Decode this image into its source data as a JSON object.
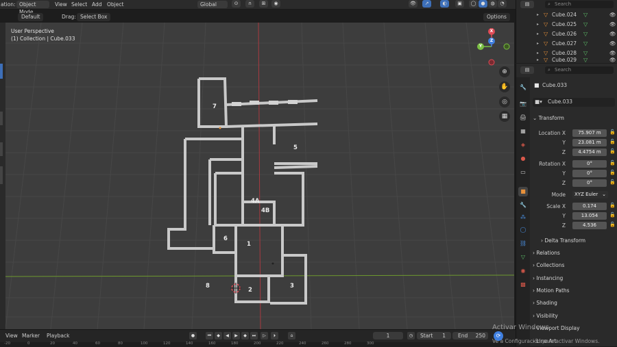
{
  "header": {
    "mode_prefix": "ation:",
    "mode": "Object Mode",
    "menus": [
      "View",
      "Select",
      "Add",
      "Object"
    ],
    "transform_orientation": "Global",
    "options": "Options"
  },
  "tool_header": {
    "orientation": "Default",
    "drag_label": "Drag:",
    "drag_value": "Select Box"
  },
  "viewport": {
    "perspective": "User Perspective",
    "collection": "(1) Collection | Cube.033",
    "room_labels": [
      "7",
      "5",
      "4A",
      "4B",
      "6",
      "1",
      "8",
      "2",
      "3"
    ],
    "gizmo": {
      "x": "X",
      "y": "Y",
      "z": "Z"
    }
  },
  "timeline": {
    "menus": [
      "View",
      "Marker",
      "Playback"
    ],
    "current_frame": "1",
    "start_label": "Start",
    "start": "1",
    "end_label": "End",
    "end": "250",
    "ruler": [
      "-20",
      "0",
      "20",
      "40",
      "60",
      "80",
      "100",
      "120",
      "140",
      "160",
      "180",
      "200",
      "220",
      "240",
      "260",
      "280",
      "300"
    ]
  },
  "outliner": {
    "search_placeholder": "Search",
    "items": [
      "Cube.024",
      "Cube.025",
      "Cube.026",
      "Cube.027",
      "Cube.028",
      "Cube.029"
    ]
  },
  "properties": {
    "search_placeholder": "Search",
    "object_name": "Cube.033",
    "data_name": "Cube.033",
    "transform_header": "Transform",
    "location": {
      "label": "Location",
      "x": "75.907 m",
      "y": "23.081 m",
      "z": "4.4754 m"
    },
    "rotation": {
      "label": "Rotation",
      "x": "0°",
      "y": "0°",
      "z": "0°"
    },
    "mode": {
      "label": "Mode",
      "value": "XYZ Euler"
    },
    "scale": {
      "label": "Scale",
      "x": "0.174",
      "y": "13.054",
      "z": "4.536"
    },
    "axes": [
      "X",
      "Y",
      "Z"
    ],
    "delta": "Delta Transform",
    "sections": [
      "Relations",
      "Collections",
      "Instancing",
      "Motion Paths",
      "Shading",
      "Visibility",
      "Viewport Display",
      "Line Art"
    ]
  },
  "watermark": {
    "line1": "Activar Windows",
    "line2": "Ve a Configuración para activar Windows."
  },
  "colors": {
    "accent": "#3d6fb8",
    "x_axis": "#e04b56",
    "y_axis": "#7bc043",
    "z_axis": "#3f7fe0"
  }
}
